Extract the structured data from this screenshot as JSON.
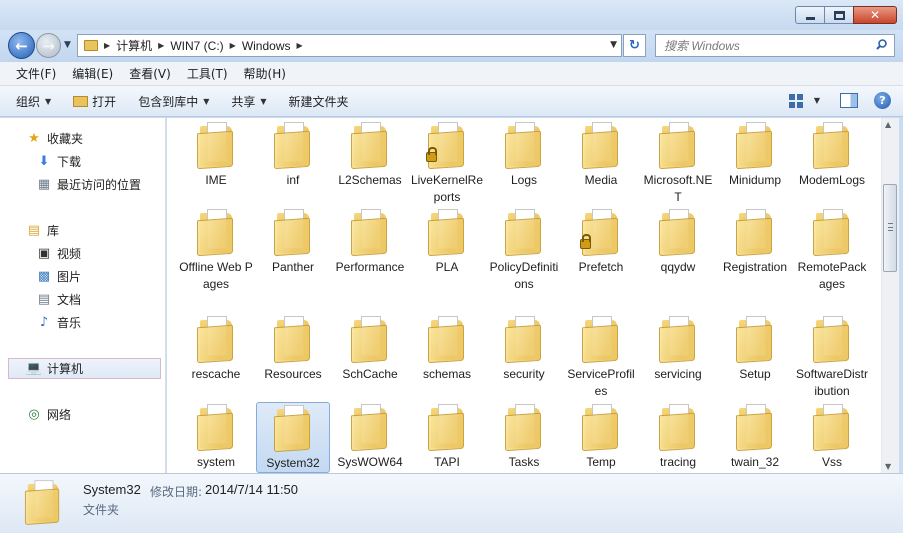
{
  "window": {
    "minimize_label": "—",
    "maximize_label": "□",
    "close_label": "✕"
  },
  "nav": {
    "breadcrumbs": [
      "计算机",
      "WIN7 (C:)",
      "Windows"
    ],
    "search_placeholder": "搜索 Windows"
  },
  "menu": [
    "文件(F)",
    "编辑(E)",
    "查看(V)",
    "工具(T)",
    "帮助(H)"
  ],
  "toolbar": {
    "organize": "组织",
    "open": "打开",
    "include_in_library": "包含到库中",
    "share": "共享",
    "new_folder": "新建文件夹",
    "help": "?"
  },
  "sidebar": {
    "favorites": "收藏夹",
    "downloads": "下载",
    "recent": "最近访问的位置",
    "libraries": "库",
    "videos": "视频",
    "pictures": "图片",
    "documents": "文档",
    "music": "音乐",
    "computer": "计算机",
    "network": "网络"
  },
  "folders": [
    {
      "name": "IME"
    },
    {
      "name": "inf"
    },
    {
      "name": "L2Schemas"
    },
    {
      "name": "LiveKernelReports",
      "locked": true
    },
    {
      "name": "Logs"
    },
    {
      "name": "Media"
    },
    {
      "name": "Microsoft.NET"
    },
    {
      "name": "Minidump"
    },
    {
      "name": "ModemLogs"
    },
    {
      "name": "Offline Web Pages"
    },
    {
      "name": "Panther"
    },
    {
      "name": "Performance"
    },
    {
      "name": "PLA"
    },
    {
      "name": "PolicyDefinitions"
    },
    {
      "name": "Prefetch",
      "locked": true
    },
    {
      "name": "qqydw"
    },
    {
      "name": "Registration"
    },
    {
      "name": "RemotePackages"
    },
    {
      "name": "rescache"
    },
    {
      "name": "Resources"
    },
    {
      "name": "SchCache"
    },
    {
      "name": "schemas"
    },
    {
      "name": "security"
    },
    {
      "name": "ServiceProfiles"
    },
    {
      "name": "servicing"
    },
    {
      "name": "Setup"
    },
    {
      "name": "SoftwareDistribution"
    },
    {
      "name": "system"
    },
    {
      "name": "System32",
      "selected": true
    },
    {
      "name": "SysWOW64"
    },
    {
      "name": "TAPI"
    },
    {
      "name": "Tasks"
    },
    {
      "name": "Temp"
    },
    {
      "name": "tracing"
    },
    {
      "name": "twain_32"
    },
    {
      "name": "Vss"
    }
  ],
  "details": {
    "name": "System32",
    "modified_label": "修改日期:",
    "modified_value": "2014/7/14 11:50",
    "type": "文件夹"
  }
}
